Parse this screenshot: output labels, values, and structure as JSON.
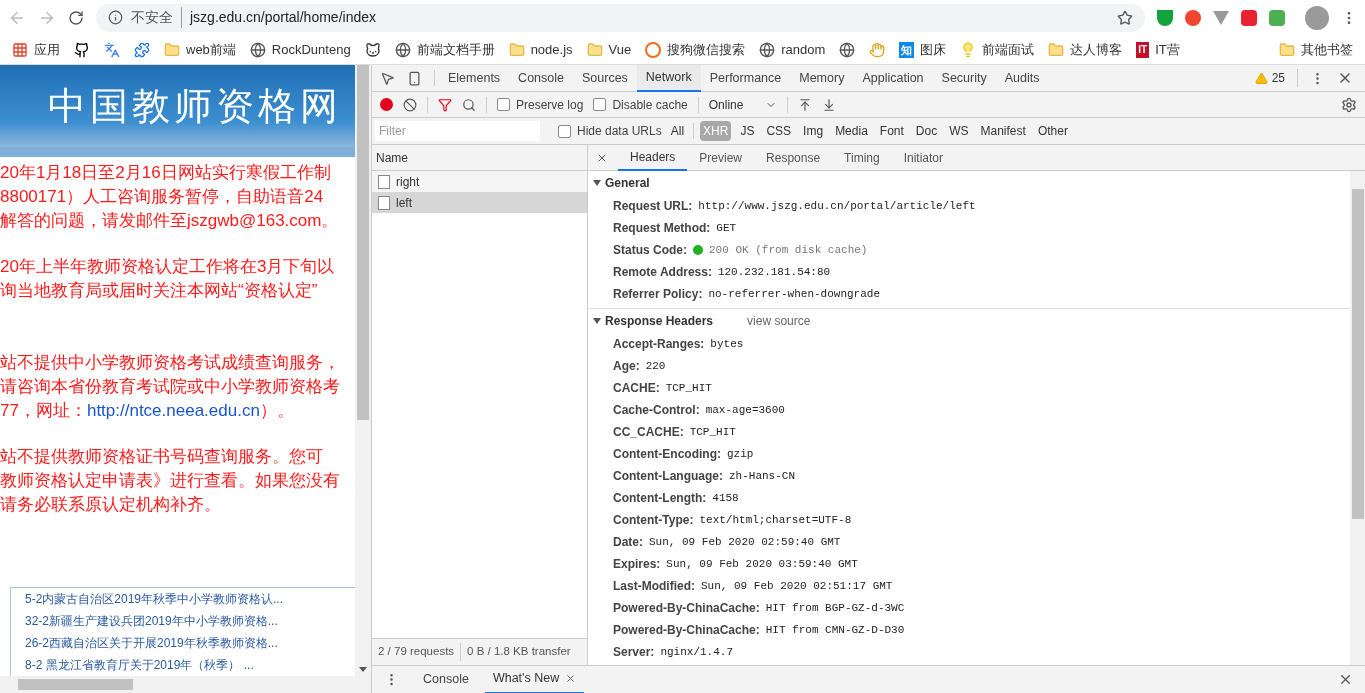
{
  "browser": {
    "security_label": "不安全",
    "url": "jszg.edu.cn/portal/home/index"
  },
  "bookmarks": [
    {
      "kind": "apps",
      "label": "应用"
    },
    {
      "kind": "github"
    },
    {
      "kind": "translate"
    },
    {
      "kind": "puzzle"
    },
    {
      "kind": "folder",
      "label": "web前端"
    },
    {
      "kind": "globe",
      "label": "RockDunteng"
    },
    {
      "kind": "cat"
    },
    {
      "kind": "globe",
      "label": "前端文档手册"
    },
    {
      "kind": "folder",
      "label": "node.js"
    },
    {
      "kind": "folder",
      "label": "Vue"
    },
    {
      "kind": "sogou",
      "label": "搜狗微信搜索"
    },
    {
      "kind": "globe",
      "label": "random"
    },
    {
      "kind": "globe"
    },
    {
      "kind": "hand"
    },
    {
      "kind": "zhihu",
      "badge": "知",
      "label": "图床"
    },
    {
      "kind": "bulb",
      "label": "前端面试"
    },
    {
      "kind": "folder",
      "label": "达人博客"
    },
    {
      "kind": "itying",
      "badge": "IT",
      "label": "IT营"
    },
    {
      "kind": "folder",
      "label": "其他书签"
    }
  ],
  "page": {
    "site_title": "中国教师资格网",
    "notices": [
      {
        "lines": [
          {
            "text": "20年1月18日至2月16日网站实行寒假工作制"
          },
          {
            "text": "8800171）人工咨询服务暂停，自助语音24"
          },
          {
            "text": "解答的问题，请发邮件至jszgwb@163.com。"
          }
        ]
      },
      {
        "lines": [
          {
            "text": "20年上半年教师资格认定工作将在3月下旬以"
          },
          {
            "text": "询当地教育局或届时关注本网站“资格认定”"
          }
        ]
      },
      {
        "lines": [
          {
            "text": "站不提供中小学教师资格考试成绩查询服务，"
          },
          {
            "text": "请咨询本省份教育考试院或中小学教师资格考"
          },
          {
            "text": "77，网址：",
            "link": "http://ntce.neea.edu.cn",
            "after": "）。"
          }
        ]
      },
      {
        "lines": [
          {
            "text": "站不提供教师资格证书号码查询服务。您可"
          },
          {
            "text": "教师资格认定申请表》进行查看。如果您没有"
          },
          {
            "text": "请务必联系原认定机构补齐。"
          }
        ]
      }
    ],
    "news": [
      "5-2内蒙古自治区2019年秋季中小学教师资格认...",
      "32-2新疆生产建设兵团2019年中小学教师资格...",
      "26-2西藏自治区关于开展2019年秋季教师资格...",
      "8-2 黑龙江省教育厅关于2019年（秋季） ..."
    ]
  },
  "devtools": {
    "tabs": [
      {
        "label": "Elements",
        "selected": false
      },
      {
        "label": "Console",
        "selected": false
      },
      {
        "label": "Sources",
        "selected": false
      },
      {
        "label": "Network",
        "selected": true
      },
      {
        "label": "Performance",
        "selected": false
      },
      {
        "label": "Memory",
        "selected": false
      },
      {
        "label": "Application",
        "selected": false
      },
      {
        "label": "Security",
        "selected": false
      },
      {
        "label": "Audits",
        "selected": false
      }
    ],
    "warnings": "25",
    "toolbar": {
      "recording": true,
      "preserve_log": {
        "label": "Preserve log",
        "checked": false
      },
      "disable_cache": {
        "label": "Disable cache",
        "checked": false
      },
      "throttling": "Online"
    },
    "filter": {
      "placeholder": "Filter",
      "hide_data_urls": {
        "label": "Hide data URLs",
        "checked": false
      },
      "types": [
        {
          "label": "All",
          "selected": false
        },
        {
          "label": "XHR",
          "selected": true
        },
        {
          "label": "JS",
          "selected": false
        },
        {
          "label": "CSS",
          "selected": false
        },
        {
          "label": "Img",
          "selected": false
        },
        {
          "label": "Media",
          "selected": false
        },
        {
          "label": "Font",
          "selected": false
        },
        {
          "label": "Doc",
          "selected": false
        },
        {
          "label": "WS",
          "selected": false
        },
        {
          "label": "Manifest",
          "selected": false
        },
        {
          "label": "Other",
          "selected": false
        }
      ]
    },
    "requests": {
      "column": "Name",
      "rows": [
        {
          "name": "right",
          "selected": false
        },
        {
          "name": "left",
          "selected": true
        }
      ],
      "summary": "2 / 79 requests",
      "transferred": "0 B / 1.8 KB transfer"
    },
    "detail_tabs": [
      {
        "label": "Headers",
        "selected": true
      },
      {
        "label": "Preview",
        "selected": false
      },
      {
        "label": "Response",
        "selected": false
      },
      {
        "label": "Timing",
        "selected": false
      },
      {
        "label": "Initiator",
        "selected": false
      }
    ],
    "sections": [
      {
        "title": "General",
        "expanded": true,
        "rows": [
          {
            "key": "Request URL:",
            "value": "http://www.jszg.edu.cn/portal/article/left"
          },
          {
            "key": "Request Method:",
            "value": "GET"
          },
          {
            "key": "Status Code:",
            "value": "200 OK (from disk cache)",
            "color": "#22b022"
          },
          {
            "key": "Remote Address:",
            "value": "120.232.181.54:80"
          },
          {
            "key": "Referrer Policy:",
            "value": "no-referrer-when-downgrade"
          }
        ]
      },
      {
        "title": "Response Headers",
        "expanded": true,
        "link": "view source",
        "rows": [
          {
            "key": "Accept-Ranges:",
            "value": "bytes"
          },
          {
            "key": "Age:",
            "value": "220"
          },
          {
            "key": "CACHE:",
            "value": "TCP_HIT"
          },
          {
            "key": "Cache-Control:",
            "value": "max-age=3600"
          },
          {
            "key": "CC_CACHE:",
            "value": "TCP_HIT"
          },
          {
            "key": "Content-Encoding:",
            "value": "gzip"
          },
          {
            "key": "Content-Language:",
            "value": "zh-Hans-CN"
          },
          {
            "key": "Content-Length:",
            "value": "4158"
          },
          {
            "key": "Content-Type:",
            "value": "text/html;charset=UTF-8"
          },
          {
            "key": "Date:",
            "value": "Sun, 09 Feb 2020 02:59:40 GMT"
          },
          {
            "key": "Expires:",
            "value": "Sun, 09 Feb 2020 03:59:40 GMT"
          },
          {
            "key": "Last-Modified:",
            "value": "Sun, 09 Feb 2020 02:51:17 GMT"
          },
          {
            "key": "Powered-By-ChinaCache:",
            "value": "HIT from BGP-GZ-d-3WC"
          },
          {
            "key": "Powered-By-ChinaCache:",
            "value": "HIT from CMN-GZ-D-D30"
          },
          {
            "key": "Server:",
            "value": "nginx/1.4.7"
          }
        ]
      }
    ],
    "drawer_tabs": [
      {
        "label": "Console",
        "selected": false,
        "closable": false
      },
      {
        "label": "What's New",
        "selected": true,
        "closable": true
      }
    ]
  }
}
